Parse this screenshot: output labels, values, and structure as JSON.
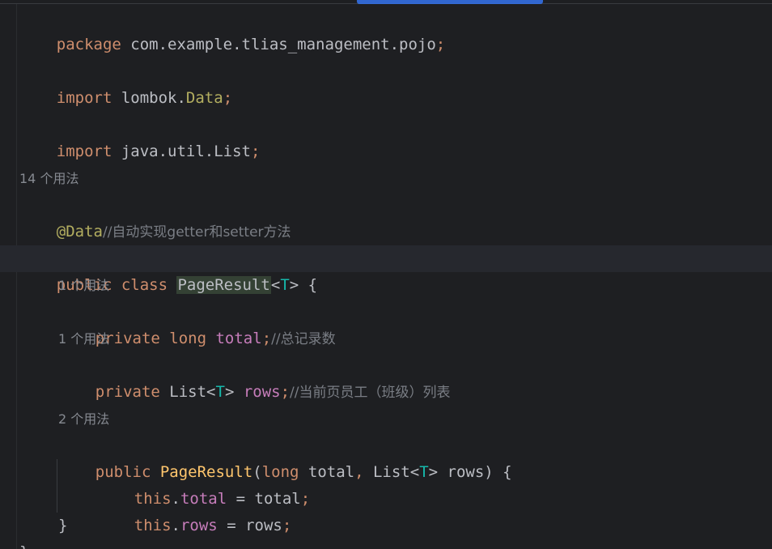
{
  "editor": {
    "code": {
      "l1": {
        "kw": "package",
        "rest": " com.example.tlias_management.pojo",
        "semi": ";"
      },
      "l2": {
        "kw": "import",
        "pkg": " lombok.",
        "cls": "Data",
        "semi": ";"
      },
      "l3": {
        "kw": "import",
        "rest": " java.util.List",
        "semi": ";"
      },
      "hint_data": "14 个用法",
      "l4": {
        "ann": "@Data",
        "comment": "//自动实现getter和setter方法"
      },
      "l5": {
        "kw": "public class ",
        "cls": "PageResult",
        "open": "<",
        "tparam": "T",
        "close": "> {"
      },
      "hint_total": "1 个用法",
      "l6": {
        "kw": "private long ",
        "field": "total",
        "semi": ";",
        "comment": "//总记录数"
      },
      "hint_rows": "1 个用法",
      "l7": {
        "kw": "private ",
        "type": "List<",
        "tparam": "T",
        "type_close": "> ",
        "field": "rows",
        "semi": ";",
        "comment": "//当前页员工（班级）列表"
      },
      "hint_ctor": "2 个用法",
      "l8": {
        "kw": "public ",
        "name": "PageResult",
        "p_open": "(",
        "p_kw": "long",
        "p_total": " total",
        "comma": ", ",
        "p_list": "List<",
        "tparam": "T",
        "p_rows": "> rows) {"
      },
      "l9": {
        "kw": "this",
        "dot": ".",
        "field": "total",
        "eq": " = total",
        "semi": ";"
      },
      "l10": {
        "kw": "this",
        "dot": ".",
        "field": "rows",
        "eq": " = rows",
        "semi": ";"
      },
      "l11": "}",
      "l12": "}"
    }
  }
}
